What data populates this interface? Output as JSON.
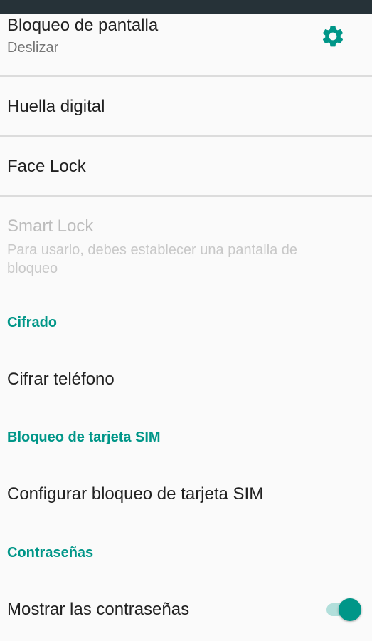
{
  "screen_lock": {
    "title": "Bloqueo de pantalla",
    "summary": "Deslizar",
    "settings_icon": "gear-icon"
  },
  "fingerprint": {
    "title": "Huella digital"
  },
  "face_lock": {
    "title": "Face Lock"
  },
  "smart_lock": {
    "title": "Smart Lock",
    "summary": "Para usarlo, debes establecer una pantalla de bloqueo"
  },
  "encryption": {
    "header": "Cifrado",
    "encrypt_phone": "Cifrar teléfono"
  },
  "sim_lock": {
    "header": "Bloqueo de tarjeta SIM",
    "configure": "Configurar bloqueo de tarjeta SIM"
  },
  "passwords": {
    "header": "Contraseñas",
    "show_passwords": "Mostrar las contraseñas",
    "show_passwords_enabled": true
  },
  "colors": {
    "accent": "#009688",
    "status_bar": "#263238",
    "background": "#fafafa"
  }
}
